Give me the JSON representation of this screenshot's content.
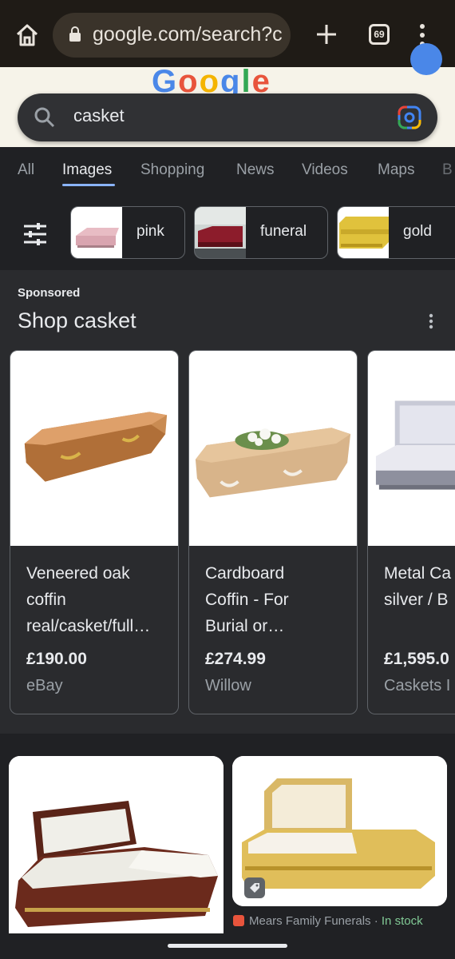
{
  "browser": {
    "url": "google.com/search?c",
    "tab_count": "69"
  },
  "doodle": {
    "logo_text": "Google"
  },
  "search": {
    "query": "casket"
  },
  "tabs": [
    "All",
    "Images",
    "Shopping",
    "News",
    "Videos",
    "Maps",
    "B"
  ],
  "active_tab": "Images",
  "chips": [
    {
      "label": "pink"
    },
    {
      "label": "funeral"
    },
    {
      "label": "gold"
    }
  ],
  "sponsored": {
    "label": "Sponsored",
    "title": "Shop casket",
    "products": [
      {
        "title": "Veneered oak\ncoffin\nreal/casket/full…",
        "price": "£190.00",
        "seller": "eBay"
      },
      {
        "title": "Cardboard\nCoffin - For\nBurial or…",
        "price": "£274.99",
        "seller": "Willow"
      },
      {
        "title": "Metal Ca\nsilver / B",
        "price": "£1,595.0",
        "seller": "Caskets I"
      }
    ]
  },
  "result_source": {
    "name": "Mears Family Funerals",
    "separator": " · ",
    "stock": "In stock"
  },
  "colors": {
    "accent": "#8ab4f8",
    "background": "#202124",
    "in_stock": "#81c995"
  }
}
